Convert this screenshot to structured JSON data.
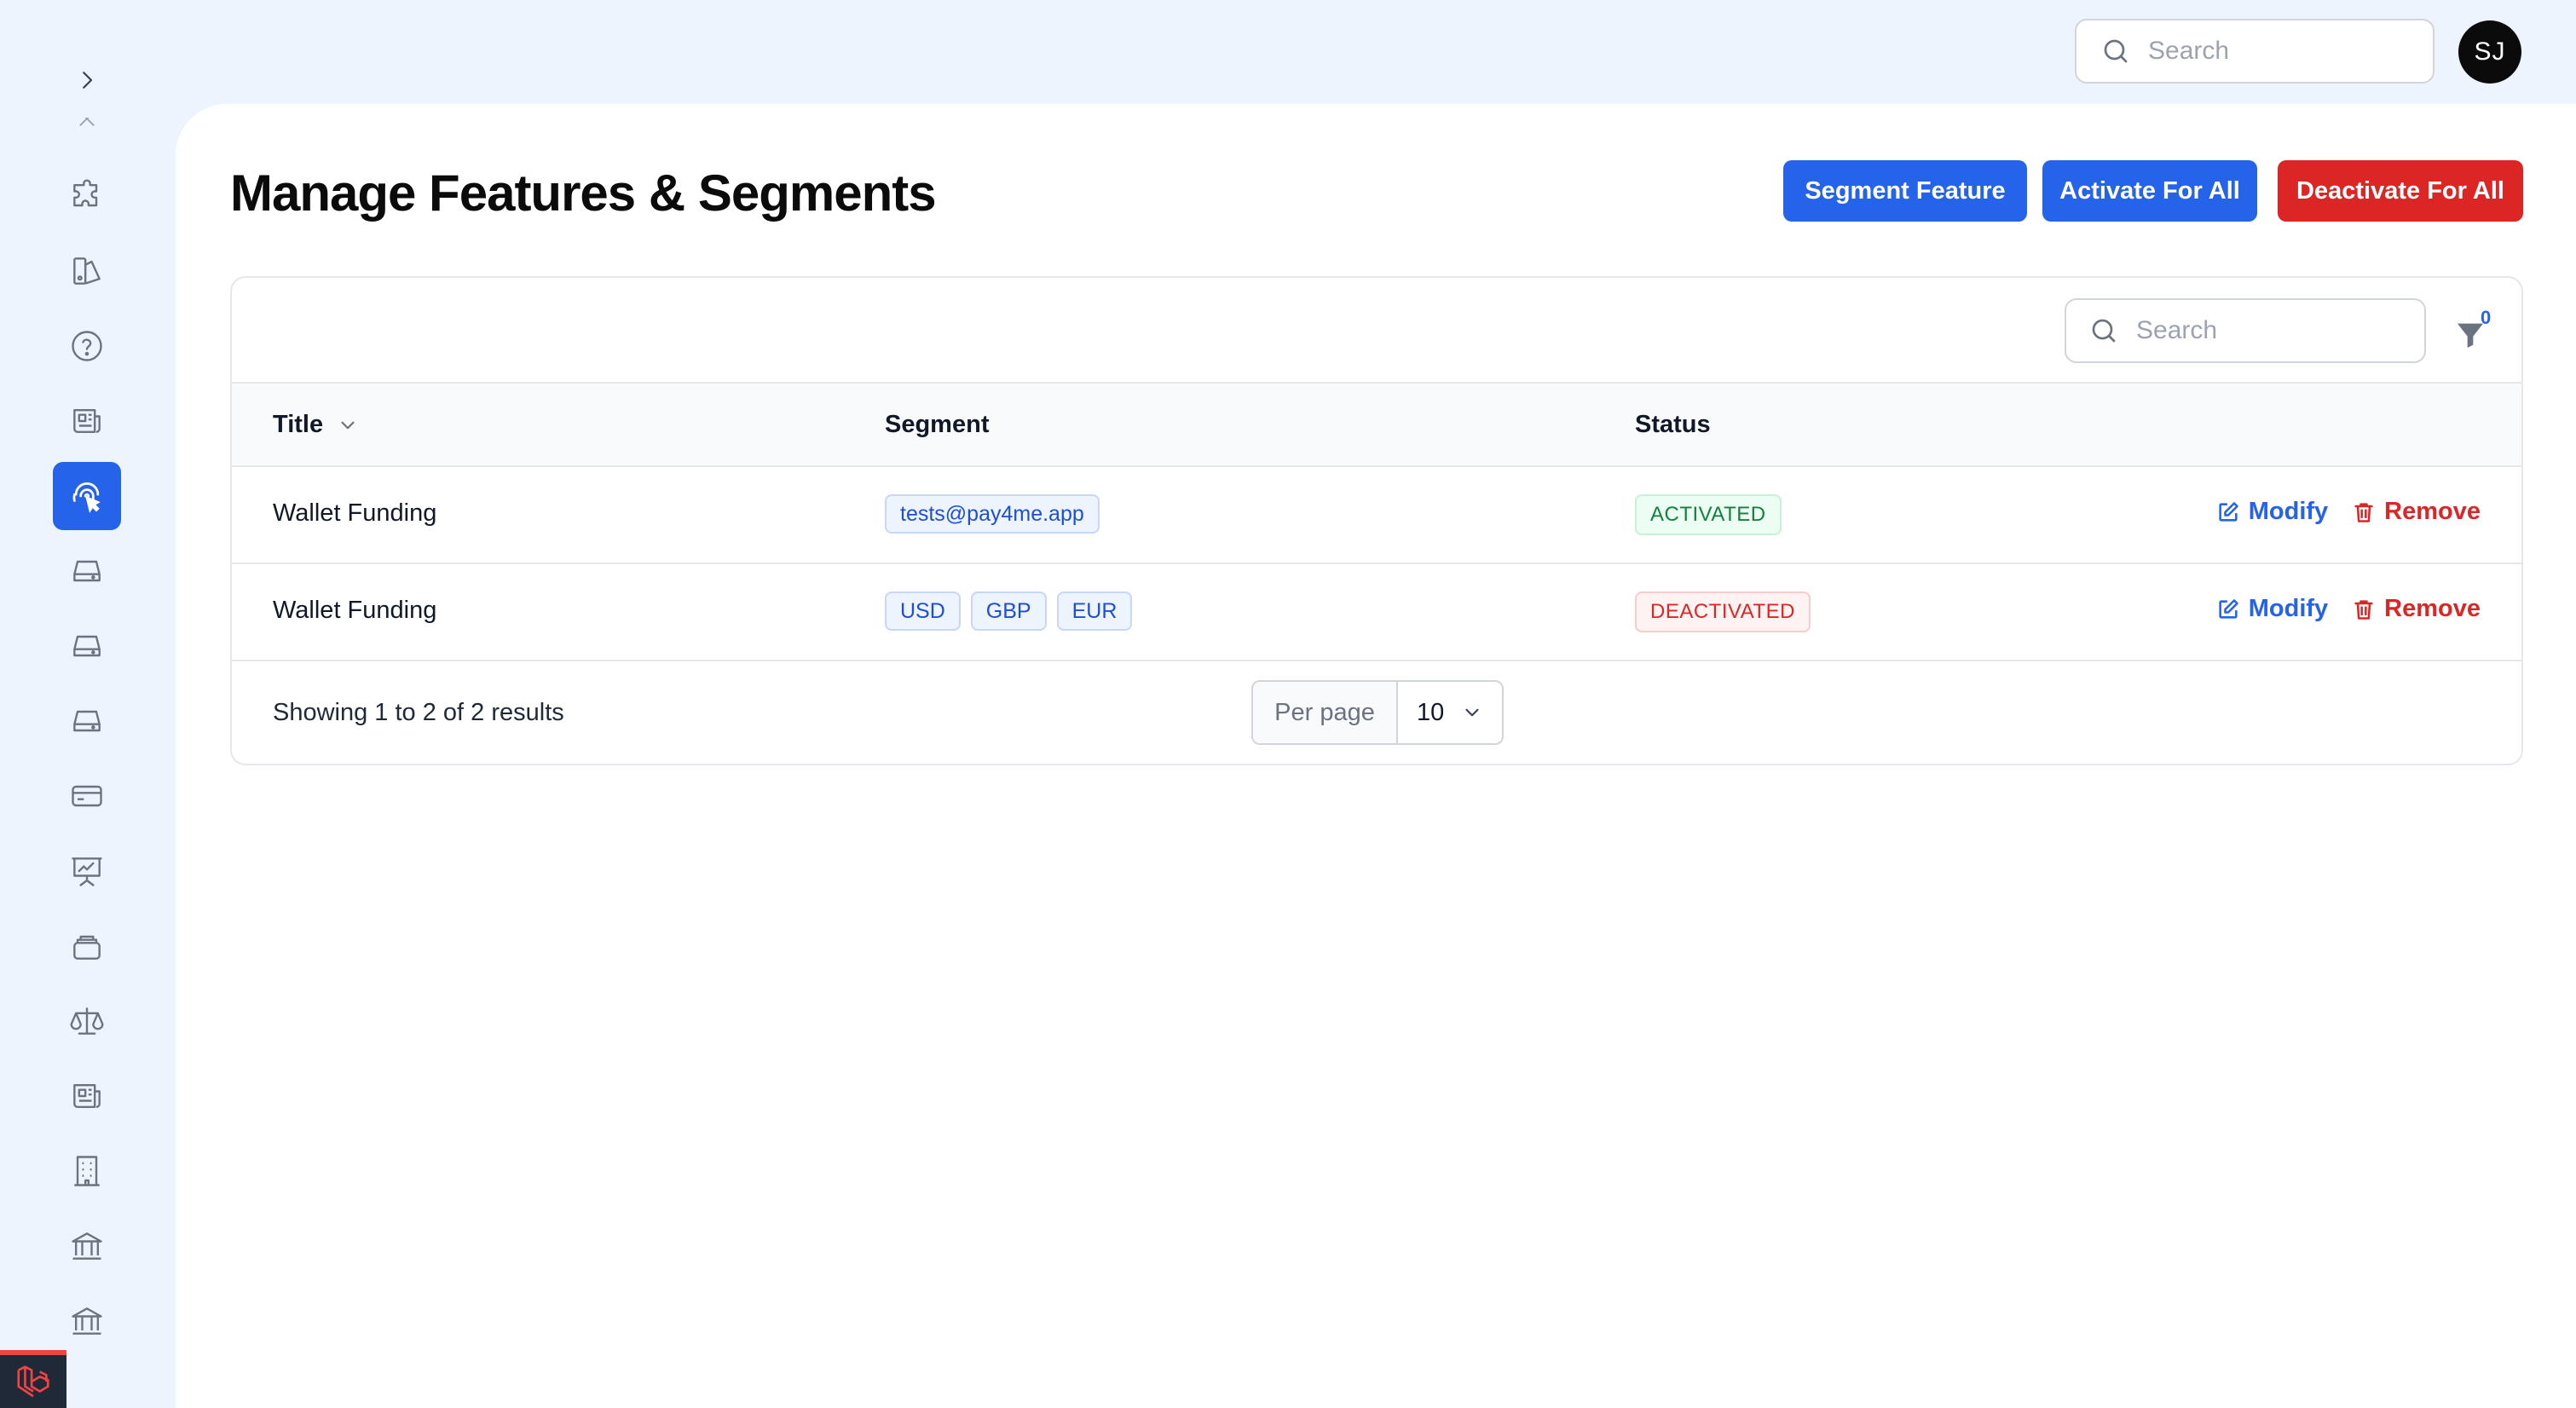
{
  "topbar": {
    "search_placeholder": "Search",
    "avatar_initials": "SJ"
  },
  "sidebar": {
    "items": [
      {
        "icon": "puzzle-icon"
      },
      {
        "icon": "paint-swatch-icon"
      },
      {
        "icon": "help-circle-icon"
      },
      {
        "icon": "newspaper-icon"
      },
      {
        "icon": "fingerprint-icon",
        "active": true
      },
      {
        "icon": "hard-drive-icon"
      },
      {
        "icon": "hard-drive-icon"
      },
      {
        "icon": "hard-drive-icon"
      },
      {
        "icon": "credit-card-icon"
      },
      {
        "icon": "presentation-chart-icon"
      },
      {
        "icon": "stack-icon"
      },
      {
        "icon": "scale-icon"
      },
      {
        "icon": "newspaper-icon"
      },
      {
        "icon": "building-icon"
      },
      {
        "icon": "bank-icon"
      },
      {
        "icon": "bank-icon"
      }
    ]
  },
  "page": {
    "title": "Manage Features & Segments",
    "buttons": {
      "segment_feature": "Segment Feature",
      "activate_all": "Activate For All",
      "deactivate_all": "Deactivate For All"
    }
  },
  "table": {
    "search_placeholder": "Search",
    "filter_count": "0",
    "columns": {
      "title": "Title",
      "segment": "Segment",
      "status": "Status"
    },
    "rows": [
      {
        "title": "Wallet Funding",
        "segments": [
          "tests@pay4me.app"
        ],
        "status": "ACTIVATED",
        "modify": "Modify",
        "remove": "Remove"
      },
      {
        "title": "Wallet Funding",
        "segments": [
          "USD",
          "GBP",
          "EUR"
        ],
        "status": "DEACTIVATED",
        "modify": "Modify",
        "remove": "Remove"
      }
    ],
    "footer": {
      "results": "Showing 1 to 2 of 2 results",
      "per_page_label": "Per page",
      "per_page_value": "10"
    }
  },
  "colors": {
    "primary": "#2563eb",
    "danger": "#dc2626",
    "success": "#15803d",
    "background": "#eef4fe"
  }
}
